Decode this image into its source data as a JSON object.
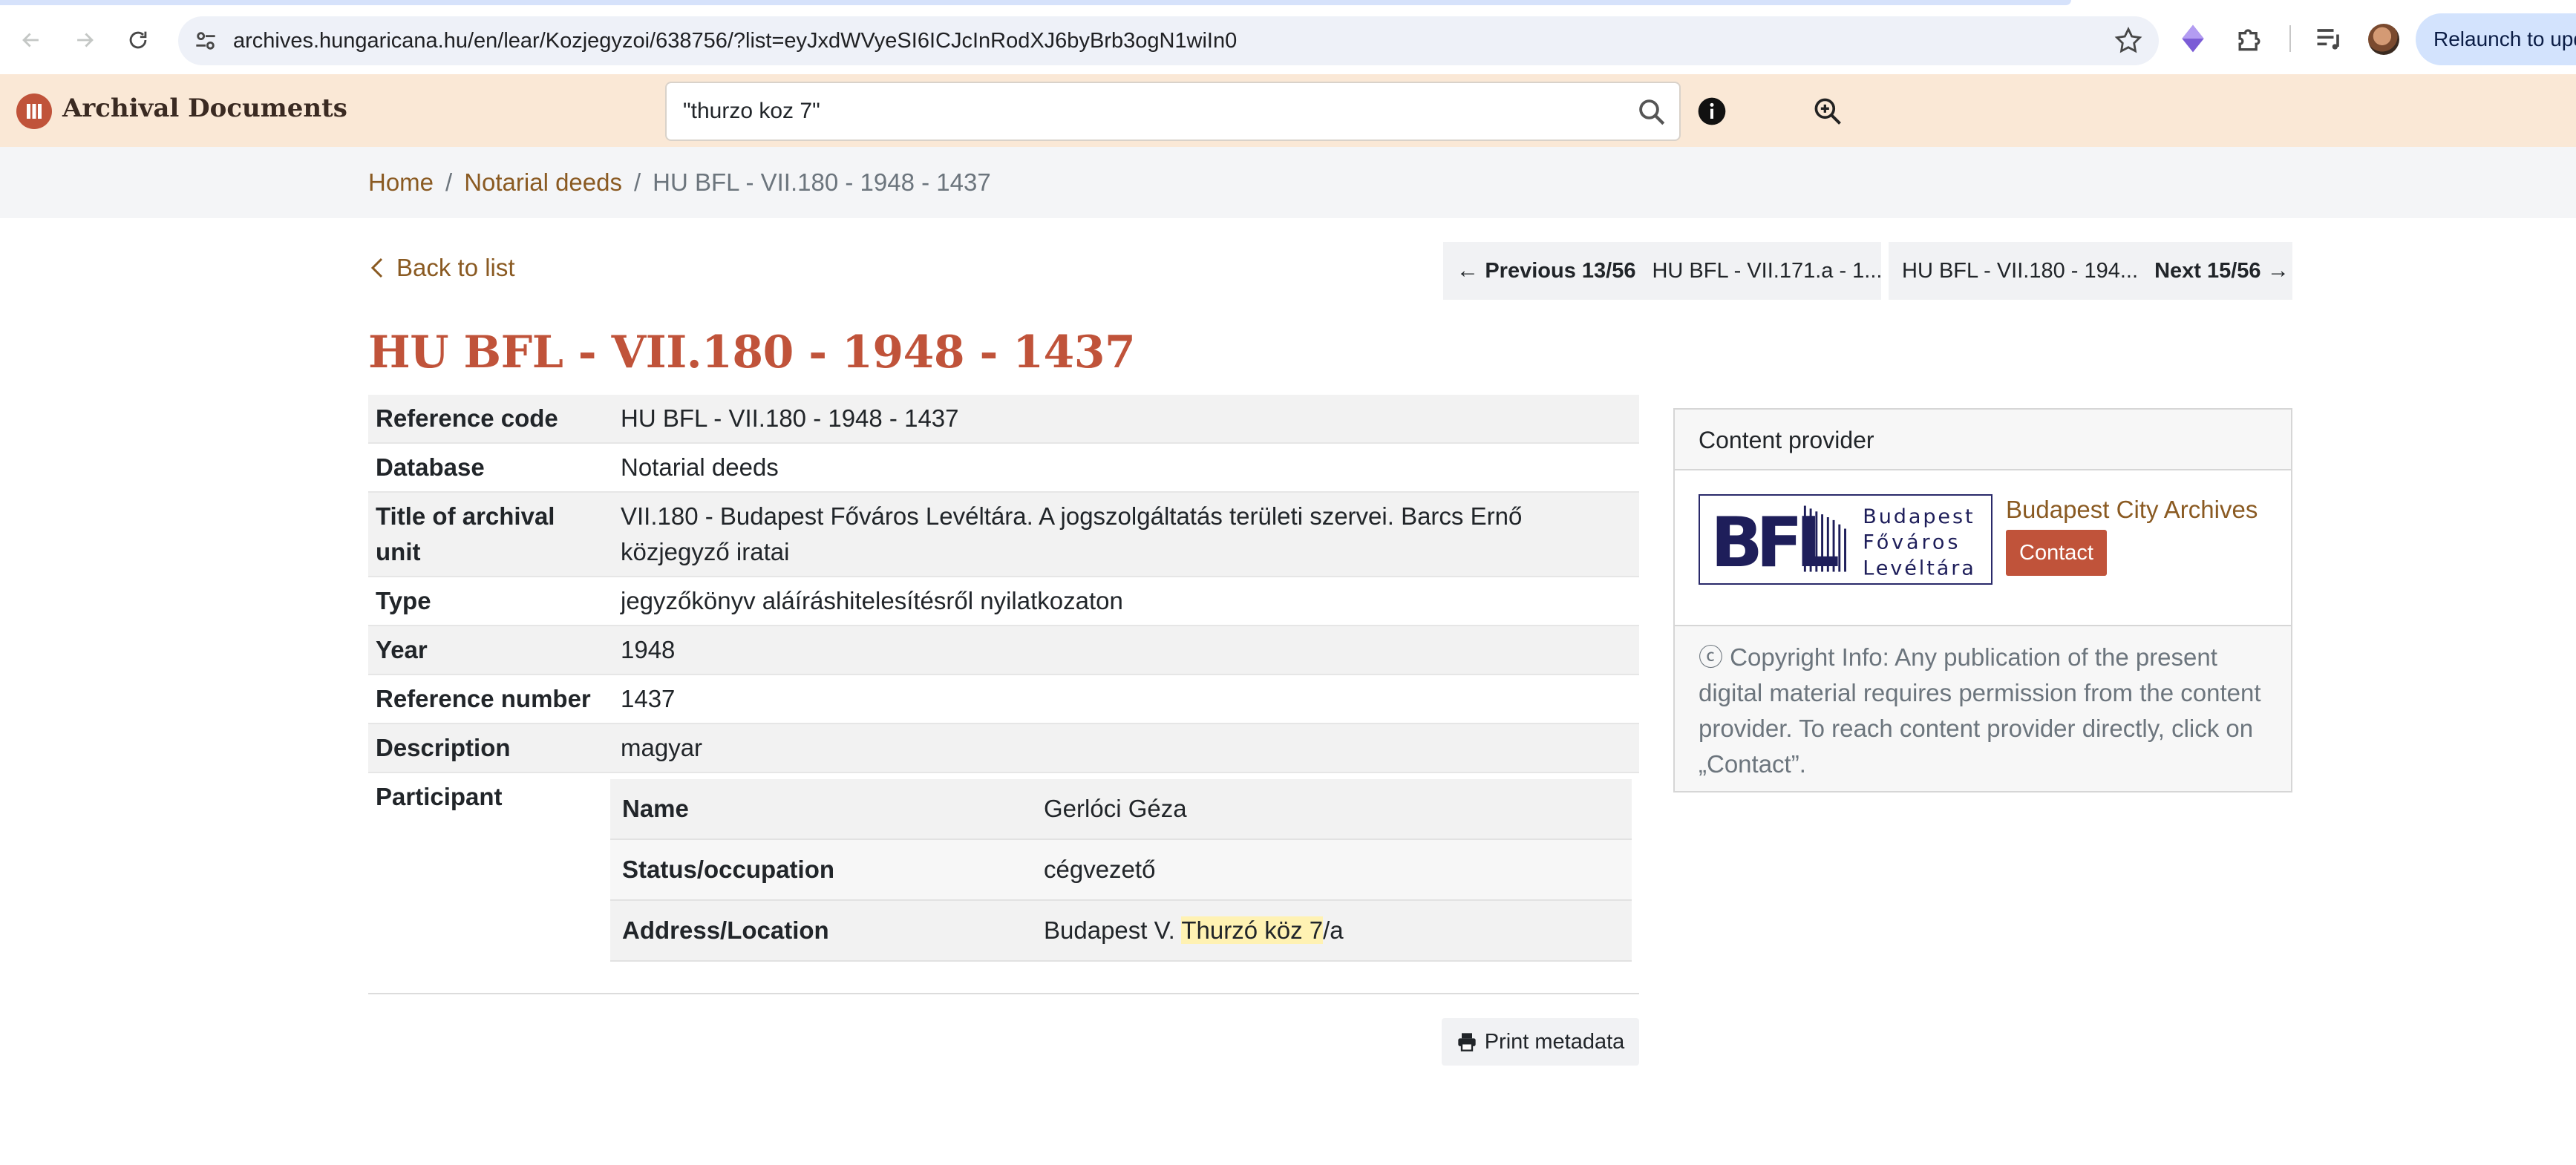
{
  "browser": {
    "url": "archives.hungaricana.hu/en/lear/Kozjegyzoi/638756/?list=eyJxdWVyeSI6ICJcInRodXJ6byBrb3ogN1wiIn0",
    "relaunch_label": "Relaunch to upd"
  },
  "header": {
    "brand": "Archival Documents",
    "search_value": "\"thurzo koz 7\""
  },
  "breadcrumb": {
    "home": "Home",
    "section": "Notarial deeds",
    "current": "HU BFL - VII.180 - 1948 - 1437"
  },
  "pager": {
    "back_label": "Back to list",
    "prev_label": "Previous 13/56",
    "prev_title": "HU BFL - VII.171.a - 1...",
    "next_title": "HU BFL - VII.180 - 194...",
    "next_label": "Next 15/56"
  },
  "document": {
    "title": "HU BFL - VII.180 - 1948 - 1437",
    "fields": [
      {
        "key": "Reference code",
        "value": "HU BFL - VII.180 - 1948 - 1437"
      },
      {
        "key": "Database",
        "value": "Notarial deeds"
      },
      {
        "key": "Title of archival unit",
        "value": "VII.180 - Budapest Főváros Levéltára. A jogszolgáltatás területi szervei. Barcs Ernő közjegyző iratai"
      },
      {
        "key": "Type",
        "value": "jegyzőkönyv aláíráshitelesítésről nyilatkozaton"
      },
      {
        "key": "Year",
        "value": "1948"
      },
      {
        "key": "Reference number",
        "value": "1437"
      },
      {
        "key": "Description",
        "value": "magyar"
      }
    ],
    "participant": {
      "label": "Participant",
      "name_key": "Name",
      "name_value": "Gerlóci Géza",
      "status_key": "Status/occupation",
      "status_value": "cégvezető",
      "address_key": "Address/Location",
      "address_prefix": "Budapest V. ",
      "address_highlight_1": "Thurzó",
      "address_highlight_2": "köz",
      "address_highlight_3": "7",
      "address_suffix": "/a"
    },
    "print_label": "Print metadata"
  },
  "provider": {
    "heading": "Content provider",
    "logo_text_1": "Budapest",
    "logo_text_2": "Főváros",
    "logo_text_3": "Levéltára",
    "logo_letters": "BFL",
    "name": "Budapest City Archives",
    "contact_label": "Contact",
    "copyright": "ⓒ Copyright Info: Any publication of the present digital material requires permission from the content provider. To reach content provider directly, click on „Contact”."
  },
  "colors": {
    "accent": "#c0533a",
    "link": "#8a5a22",
    "header_bg": "#fae8d6",
    "highlight": "#fff2b3"
  }
}
